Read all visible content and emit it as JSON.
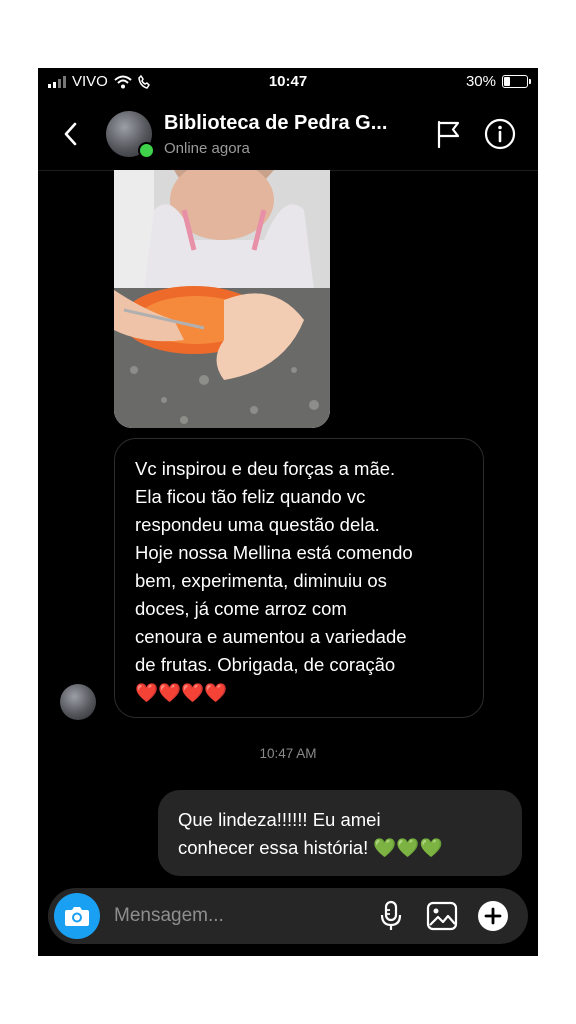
{
  "status_bar": {
    "carrier": "VIVO",
    "time": "10:47",
    "battery": "30%",
    "battery_level": 0.3
  },
  "header": {
    "title": "Biblioteca de Pedra G...",
    "status": "Online agora",
    "icons": {
      "back": "chevron-left-icon",
      "report": "flag-icon",
      "info": "info-icon"
    }
  },
  "messages": {
    "incoming_text": "Vc inspirou e deu forças a mãe.\nEla ficou tão feliz quando vc\nrespondeu uma questão dela.\nHoje nossa Mellina está comendo\nbem, experimenta, diminuiu os\ndoces, já come arroz com\ncenoura e aumentou a variedade\nde frutas. Obrigada, de coração",
    "incoming_emoji": "❤️❤️❤️❤️",
    "timestamp": "10:47 AM",
    "outgoing_text": "Que lindeza!!!!!! Eu amei\nconhecer essa história!",
    "outgoing_emoji": "💚💚💚"
  },
  "composer": {
    "placeholder": "Mensagem...",
    "icons": {
      "camera": "camera-icon",
      "mic": "microphone-icon",
      "gallery": "image-icon",
      "add": "plus-icon"
    }
  },
  "colors": {
    "accent_blue": "#1aa0f2",
    "online_green": "#3fd24a",
    "outgoing_bubble": "#262626",
    "background": "#000000"
  }
}
